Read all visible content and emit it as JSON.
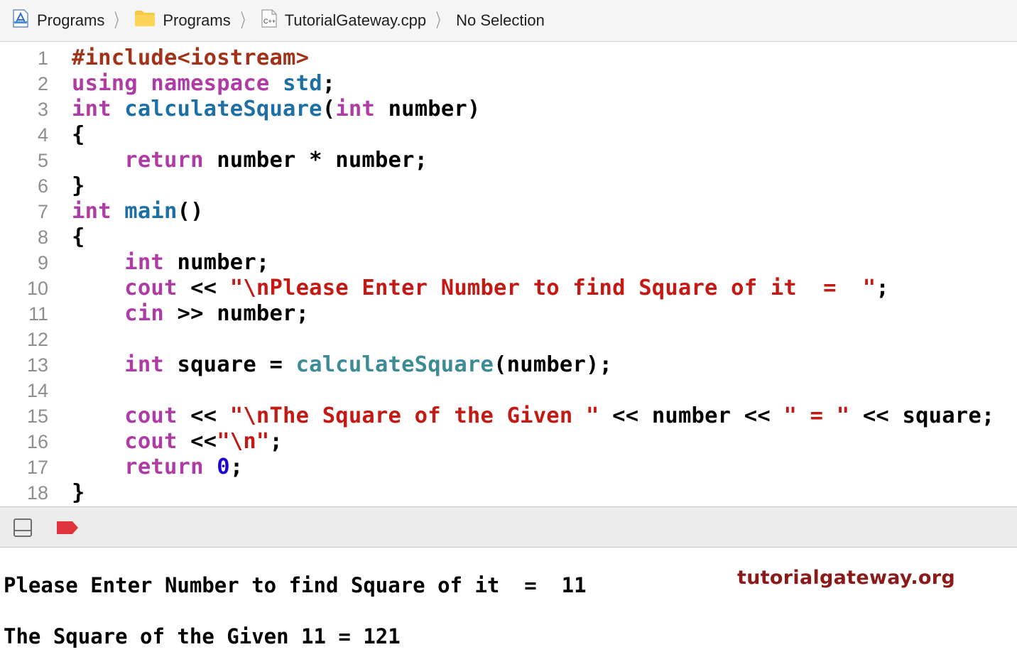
{
  "breadcrumb": {
    "items": [
      {
        "label": "Programs",
        "icon": "xcode-project-icon"
      },
      {
        "label": "Programs",
        "icon": "folder-icon"
      },
      {
        "label": "TutorialGateway.cpp",
        "icon": "cpp-file-icon"
      },
      {
        "label": "No Selection",
        "icon": ""
      }
    ],
    "cpp_badge": "C++"
  },
  "editor": {
    "line_numbers": [
      "1",
      "2",
      "3",
      "4",
      "5",
      "6",
      "7",
      "8",
      "9",
      "10",
      "11",
      "12",
      "13",
      "14",
      "15",
      "16",
      "17",
      "18"
    ],
    "lines": [
      [
        {
          "t": "#include<iostream>",
          "c": "pp"
        }
      ],
      [
        {
          "t": "using",
          "c": "kw"
        },
        {
          "t": " "
        },
        {
          "t": "namespace",
          "c": "kw"
        },
        {
          "t": " "
        },
        {
          "t": "std",
          "c": "fn"
        },
        {
          "t": ";"
        }
      ],
      [
        {
          "t": "int",
          "c": "kw"
        },
        {
          "t": " "
        },
        {
          "t": "calculateSquare",
          "c": "fn"
        },
        {
          "t": "("
        },
        {
          "t": "int",
          "c": "kw"
        },
        {
          "t": " number)"
        }
      ],
      [
        {
          "t": "{"
        }
      ],
      [
        {
          "t": "    "
        },
        {
          "t": "return",
          "c": "kw"
        },
        {
          "t": " number * number;"
        }
      ],
      [
        {
          "t": "}"
        }
      ],
      [
        {
          "t": "int",
          "c": "kw"
        },
        {
          "t": " "
        },
        {
          "t": "main",
          "c": "fn"
        },
        {
          "t": "()"
        }
      ],
      [
        {
          "t": "{"
        }
      ],
      [
        {
          "t": "    "
        },
        {
          "t": "int",
          "c": "kw"
        },
        {
          "t": " number;"
        }
      ],
      [
        {
          "t": "    "
        },
        {
          "t": "cout",
          "c": "kw"
        },
        {
          "t": " << "
        },
        {
          "t": "\"\\nPlease Enter Number to find Square of it  =  \"",
          "c": "str"
        },
        {
          "t": ";"
        }
      ],
      [
        {
          "t": "    "
        },
        {
          "t": "cin",
          "c": "kw"
        },
        {
          "t": " >> number;"
        }
      ],
      [],
      [
        {
          "t": "    "
        },
        {
          "t": "int",
          "c": "kw"
        },
        {
          "t": " square = "
        },
        {
          "t": "calculateSquare",
          "c": "fn2"
        },
        {
          "t": "(number);"
        }
      ],
      [],
      [
        {
          "t": "    "
        },
        {
          "t": "cout",
          "c": "kw"
        },
        {
          "t": " << "
        },
        {
          "t": "\"\\nThe Square of the Given \"",
          "c": "str"
        },
        {
          "t": " << number << "
        },
        {
          "t": "\" = \"",
          "c": "str"
        },
        {
          "t": " << square;"
        }
      ],
      [
        {
          "t": "    "
        },
        {
          "t": "cout",
          "c": "kw"
        },
        {
          "t": " <<"
        },
        {
          "t": "\"\\n\"",
          "c": "str"
        },
        {
          "t": ";"
        }
      ],
      [
        {
          "t": "    "
        },
        {
          "t": "return",
          "c": "kw"
        },
        {
          "t": " "
        },
        {
          "t": "0",
          "c": "num"
        },
        {
          "t": ";"
        }
      ],
      [
        {
          "t": "}"
        }
      ]
    ]
  },
  "colors": {
    "keyword": "#ad3da4",
    "function": "#1e6fa3",
    "string": "#c41a16",
    "preprocessor": "#a0331a",
    "number": "#1c00cf",
    "breakpoint": "#e0343c",
    "watermark": "#8b1a1a"
  },
  "console": {
    "output": [
      "Please Enter Number to find Square of it  =  11",
      "The Square of the Given 11 = 121"
    ],
    "watermark": "tutorialgateway.org"
  }
}
